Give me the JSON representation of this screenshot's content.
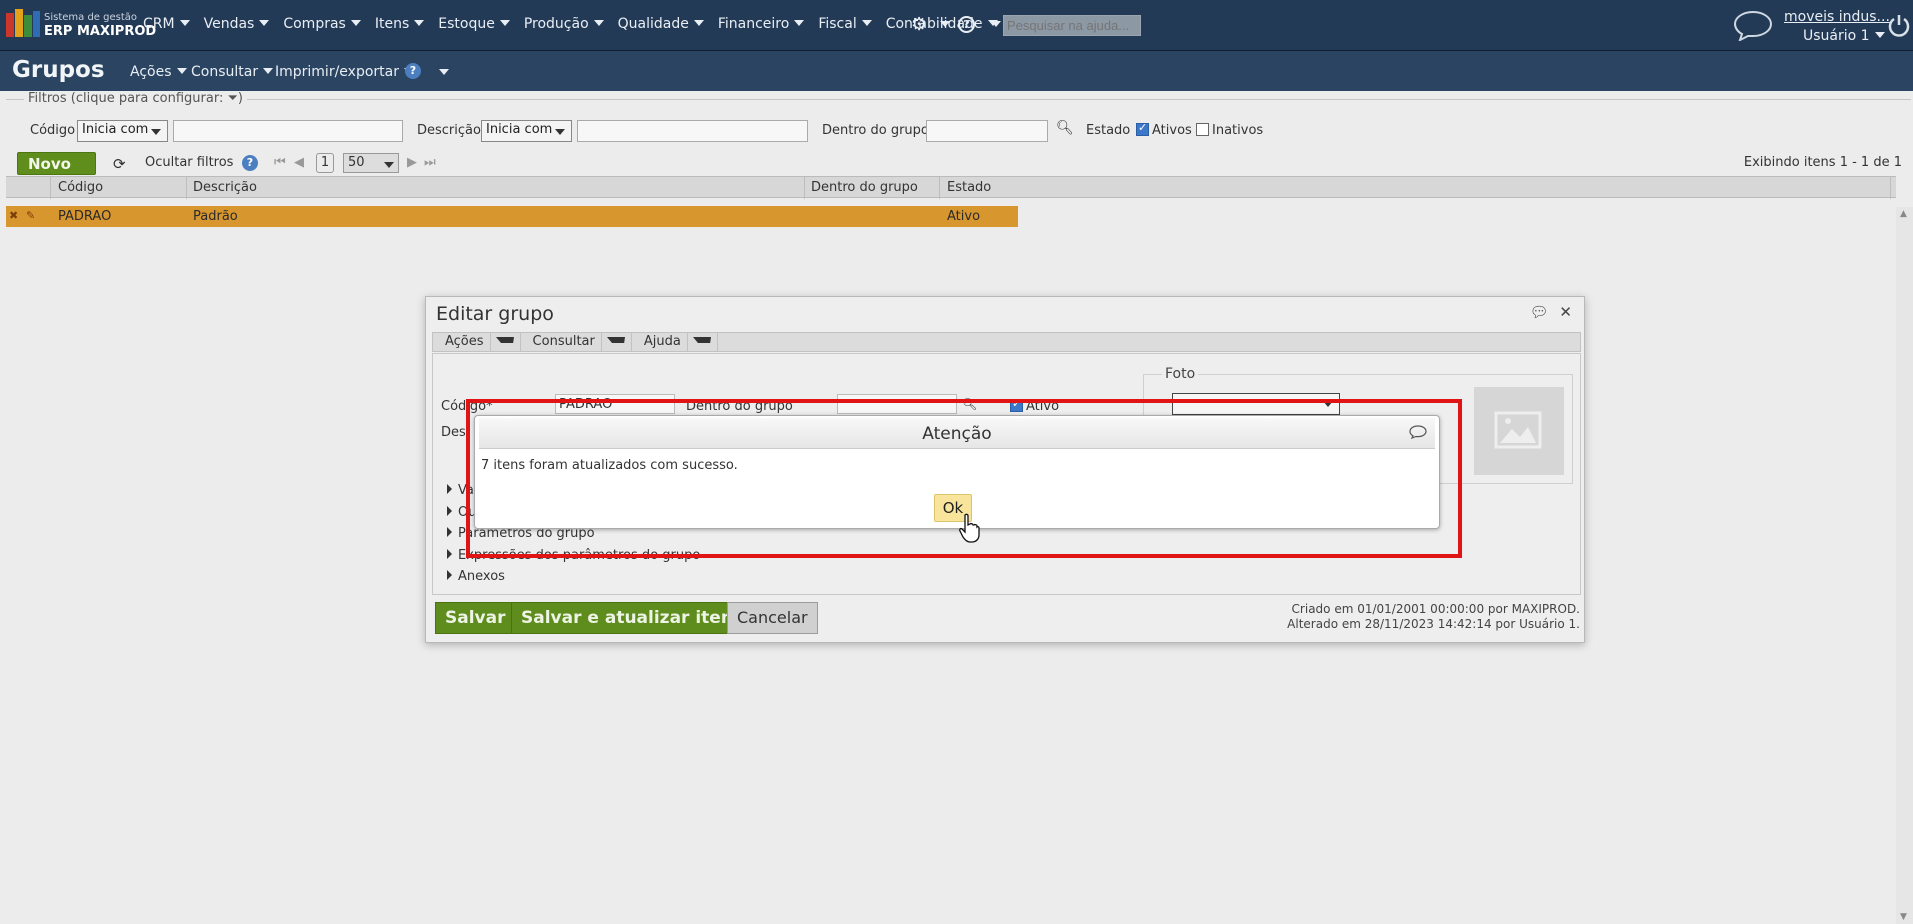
{
  "topbar": {
    "logo_line1": "Sistema de gestão",
    "logo_line2": "ERP MAXIPROD",
    "nav": [
      "CRM",
      "Vendas",
      "Compras",
      "Itens",
      "Estoque",
      "Produção",
      "Qualidade",
      "Financeiro",
      "Fiscal",
      "Contabilidade"
    ],
    "search_placeholder": "Pesquisar na ajuda...",
    "company": "moveis indus...",
    "user": "Usuário 1"
  },
  "page": {
    "title": "Grupos",
    "menu": [
      "Ações",
      "Consultar",
      "Imprimir/exportar"
    ],
    "help_label": "?"
  },
  "filters": {
    "legend": "Filtros (clique para configurar:",
    "legend_end": ")",
    "codigo_label": "Código",
    "codigo_op": "Inicia com",
    "descricao_label": "Descrição",
    "descricao_op": "Inicia com",
    "grupo_label": "Dentro do grupo",
    "estado_label": "Estado",
    "ativos_label": "Ativos",
    "ativos_checked": true,
    "inativos_label": "Inativos",
    "inativos_checked": false
  },
  "toolbar": {
    "novo_label": "Novo",
    "ocultar_label": "Ocultar filtros",
    "page_number": "1",
    "page_size": "50",
    "summary": "Exibindo itens 1 - 1 de 1"
  },
  "grid": {
    "columns": [
      "Código",
      "Descrição",
      "Dentro do grupo",
      "Estado"
    ],
    "rows": [
      {
        "codigo": "PADRAO",
        "descricao": "Padrão",
        "grupo": "",
        "estado": "Ativo"
      }
    ]
  },
  "edit_dialog": {
    "title": "Editar grupo",
    "menu": [
      "Ações",
      "Consultar",
      "Ajuda"
    ],
    "codigo_label": "Código*",
    "codigo_value": "PADRAO",
    "grupo_label": "Dentro do grupo",
    "ativo_label": "Ativo",
    "descricao_label_partial": "Des",
    "foto_label": "Foto",
    "sections": [
      "Va",
      "Ou",
      "Parâmetros do grupo",
      "Expressões dos parâmetros do grupo",
      "Anexos"
    ],
    "save_label": "Salvar",
    "save_update_label": "Salvar e atualizar itens",
    "cancel_label": "Cancelar",
    "created": "Criado em 01/01/2001 00:00:00 por MAXIPROD.",
    "updated": "Alterado em 28/11/2023 14:42:14 por Usuário 1."
  },
  "alert": {
    "title": "Atenção",
    "message": "7 itens foram atualizados com sucesso.",
    "ok_label": "Ok"
  },
  "colors": {
    "topbar": "#233a56",
    "selected_row": "#d8962e",
    "green_button": "#5e8d1d",
    "highlight": "#e01414",
    "ok_button": "#f8e49a"
  }
}
